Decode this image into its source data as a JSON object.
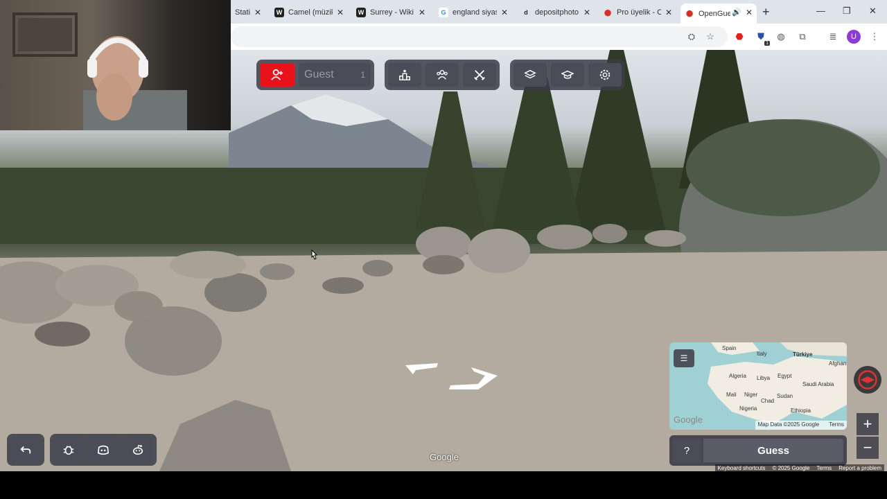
{
  "browser": {
    "tabs": [
      {
        "label": "Stati",
        "favicon": "generic"
      },
      {
        "label": "Camel (müzik",
        "favicon": "W"
      },
      {
        "label": "Surrey - Wiki",
        "favicon": "W"
      },
      {
        "label": "england siyas",
        "favicon": "G"
      },
      {
        "label": "depositphoto",
        "favicon": "d"
      },
      {
        "label": "Pro üyelik - C",
        "favicon": "pin"
      },
      {
        "label": "OpenGue",
        "favicon": "pin",
        "active": true
      }
    ],
    "profile_initial": "U",
    "extension_badge": "1"
  },
  "game": {
    "guest_label": "Guest",
    "guest_count": "1",
    "guess_help": "?",
    "guess_label": "Guess"
  },
  "minimap": {
    "labels": [
      "Spain",
      "Türkiye",
      "Italy",
      "Algeria",
      "Libya",
      "Egypt",
      "Saudi Arabia",
      "Mali",
      "Niger",
      "Chad",
      "Sudan",
      "Nigeria",
      "Ethiopia",
      "Afghani"
    ],
    "google": "Google",
    "map_data": "Map Data ©2025 Google",
    "terms": "Terms"
  },
  "streetview": {
    "google_logo": "Google",
    "footer": {
      "shortcuts": "Keyboard shortcuts",
      "copyright": "© 2025 Google",
      "terms": "Terms",
      "report": "Report a problem"
    }
  },
  "colors": {
    "accent_red": "#e8131a",
    "panel": "#4a4c58"
  }
}
